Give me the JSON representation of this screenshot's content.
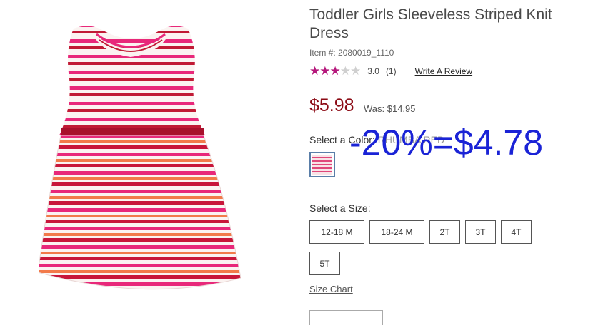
{
  "product": {
    "title": "Toddler Girls Sleeveless Striped Knit Dress",
    "item_number": "Item #: 2080019_1110",
    "image_icon": "striped-dress-image"
  },
  "rating": {
    "stars_filled": 3,
    "stars_total": 5,
    "value": "3.0",
    "count": "(1)",
    "write_review": "Write A Review",
    "star_color": "#b5187c",
    "star_empty_color": "#cfcfcf"
  },
  "price": {
    "current": "$5.98",
    "was": "Was: $14.95",
    "color": "#8b0a14"
  },
  "color_select": {
    "label": "Select a Color:",
    "value": "RHUMBA RED",
    "swatch_icon": "pink-stripe-swatch",
    "border_color": "#5a7ea8"
  },
  "overlay": {
    "text": "-20%=$4.78",
    "color": "#1a23d6"
  },
  "size_select": {
    "label": "Select a Size:",
    "options": [
      "12-18 M",
      "18-24 M",
      "2T",
      "3T",
      "4T",
      "5T"
    ],
    "chart_link": "Size Chart"
  }
}
